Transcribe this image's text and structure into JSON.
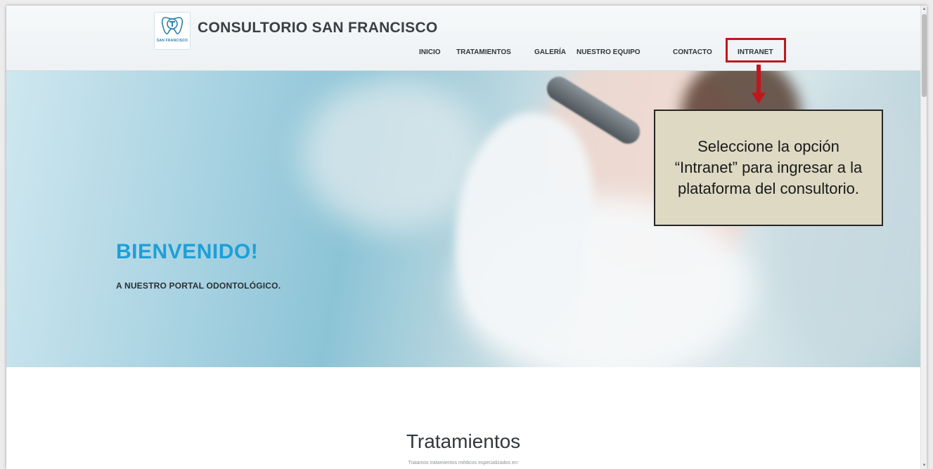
{
  "header": {
    "logo_text": "SAN FRANCISCO",
    "site_title": "CONSULTORIO SAN FRANCISCO"
  },
  "nav": {
    "items": [
      {
        "label": "INICIO"
      },
      {
        "label": "TRATAMIENTOS"
      },
      {
        "label": "GALERÍA"
      },
      {
        "label": "NUESTRO EQUIPO"
      },
      {
        "label": "CONTACTO"
      },
      {
        "label": "INTRANET"
      }
    ]
  },
  "hero": {
    "title": "BIENVENIDO!",
    "subtitle": "A NUESTRO PORTAL ODONTOLÓGICO."
  },
  "callout": {
    "text": "Seleccione la opción “Intranet” para ingresar a la plataforma del consultorio."
  },
  "section": {
    "title": "Tratamientos",
    "subtitle": "Tratamos tratamientos médicos especializados en:"
  },
  "colors": {
    "accent_blue": "#1e9fd8",
    "highlight_red": "#c0171d",
    "callout_bg": "#ddd9c3"
  },
  "icons": {
    "logo": "tooth-logo-icon",
    "scroll_up": "triangle-up-icon",
    "scroll_down": "triangle-down-icon"
  }
}
